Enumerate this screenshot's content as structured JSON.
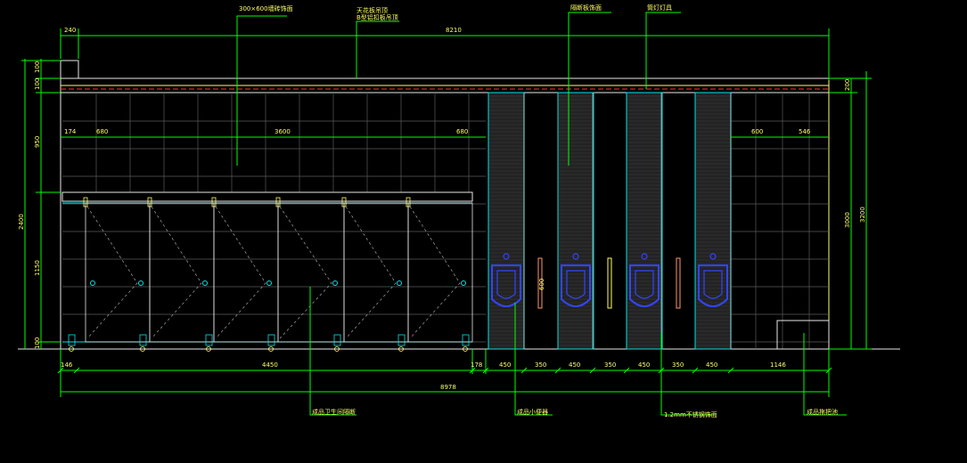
{
  "colors": {
    "background": "#000000",
    "dimension": "#00ff00",
    "wall": "#e8e8e8",
    "yellow": "#ffff66",
    "cyan": "#00e5e5",
    "red": "#ff3030",
    "blue": "#3344ff",
    "orange": "#ff9966",
    "dark_grid": "#2a2a2a"
  },
  "labels": {
    "top_tile": "300×600墙砖饰面",
    "top_ceiling_1": "天花板吊顶",
    "top_ceiling_2": "B型铝扣板吊顶",
    "top_partition": "隔断板饰面",
    "top_lamp": "筒灯灯具",
    "bottom_toilet": "成品卫生间隔断",
    "bottom_urinal": "成品小便器",
    "bottom_steel": "1.2mm不锈钢饰面",
    "bottom_basin": "成品拖把池"
  },
  "dimensions": {
    "top_left_offset": "240",
    "top_total": "8210",
    "left_segments": [
      "100",
      "100",
      "950",
      "1150",
      "100"
    ],
    "left_total": "2400",
    "right_top": "200",
    "right_main": "3000",
    "right_total": "3200",
    "row_left": [
      "174",
      "680",
      "3600",
      "680"
    ],
    "row_right": [
      "600",
      "546"
    ],
    "urinal_height": "600",
    "bottom_row": [
      "146",
      "4450",
      "178",
      "450",
      "350",
      "450",
      "350",
      "450",
      "350",
      "450",
      "1146"
    ],
    "bottom_total": "8978"
  }
}
